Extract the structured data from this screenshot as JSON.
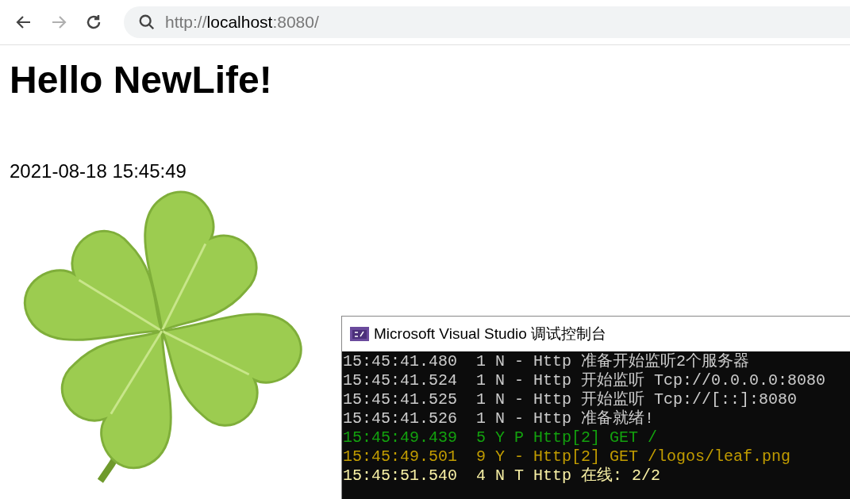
{
  "browser": {
    "back_disabled": false,
    "forward_disabled": true,
    "address": {
      "scheme": "http://",
      "host": "localhost",
      "rest": ":8080/"
    }
  },
  "page": {
    "heading": "Hello NewLife!",
    "timestamp": "2021-08-18 15:45:49"
  },
  "console_window": {
    "title": "Microsoft Visual Studio 调试控制台",
    "lines": [
      {
        "text": "15:45:41.480  1 N - Http 准备开始监听2个服务器",
        "kind": "info"
      },
      {
        "text": "15:45:41.524  1 N - Http 开始监听 Tcp://0.0.0.0:8080",
        "kind": "info"
      },
      {
        "text": "15:45:41.525  1 N - Http 开始监听 Tcp://[::]:8080",
        "kind": "info"
      },
      {
        "text": "15:45:41.526  1 N - Http 准备就绪!",
        "kind": "info"
      },
      {
        "text": "15:45:49.439  5 Y P Http[2] GET /",
        "kind": "success"
      },
      {
        "text": "15:45:49.501  9 Y - Http[2] GET /logos/leaf.png",
        "kind": "warning"
      },
      {
        "text": "15:45:51.540  4 N T Http 在线: 2/2",
        "kind": "status"
      }
    ]
  }
}
